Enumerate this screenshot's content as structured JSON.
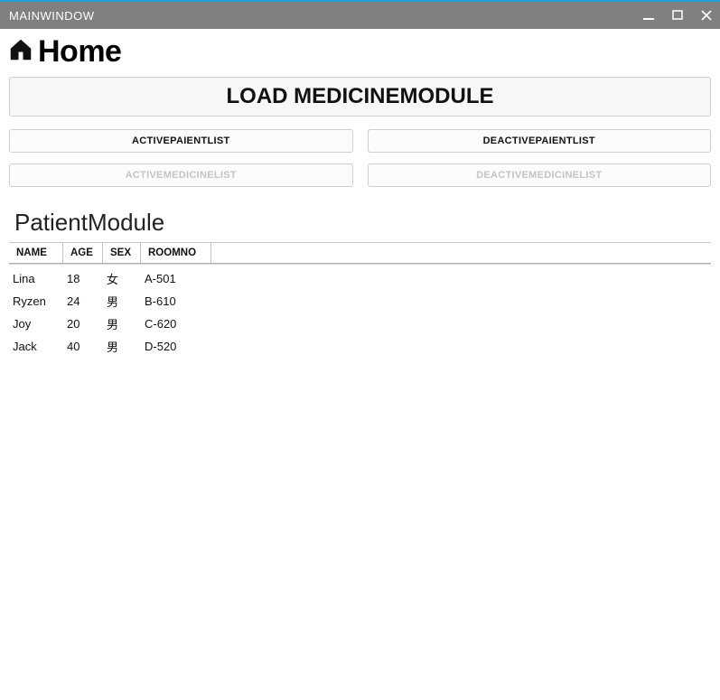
{
  "window": {
    "title": "MAINWINDOW"
  },
  "header": {
    "title": "Home"
  },
  "main_button": {
    "label": "LOAD MEDICINEMODULE"
  },
  "buttons_row1": {
    "left": "ACTIVEPAIENTLIST",
    "right": "DEACTIVEPAIENTLIST"
  },
  "buttons_row2": {
    "left": "ACTIVEMEDICINELIST",
    "right": "DEACTIVEMEDICINELIST"
  },
  "module": {
    "title": "PatientModule",
    "columns": {
      "name": "NAME",
      "age": "AGE",
      "sex": "SEX",
      "room": "ROOMNO"
    },
    "rows": [
      {
        "name": "Lina",
        "age": "18",
        "sex": "女",
        "room": "A-501"
      },
      {
        "name": "Ryzen",
        "age": "24",
        "sex": "男",
        "room": "B-610"
      },
      {
        "name": "Joy",
        "age": "20",
        "sex": "男",
        "room": "C-620"
      },
      {
        "name": "Jack",
        "age": "40",
        "sex": "男",
        "room": "D-520"
      }
    ]
  }
}
